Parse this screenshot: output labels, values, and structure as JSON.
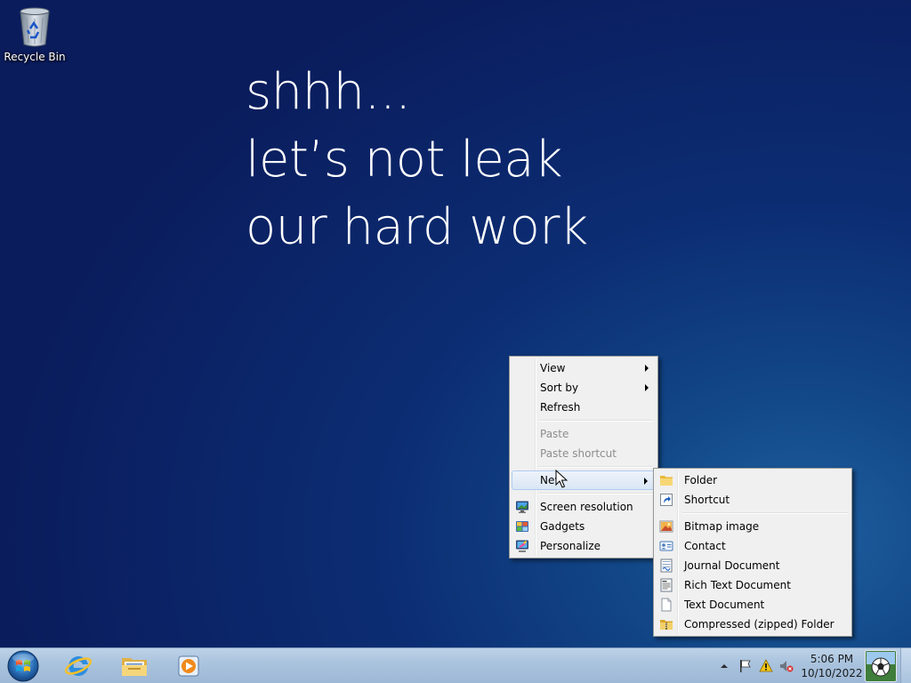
{
  "desktop": {
    "icons": [
      {
        "label": "Recycle Bin",
        "icon": "recycle-bin-icon"
      }
    ],
    "wallpaper_text": [
      "shhh...",
      "let’s not leak",
      "our hard work"
    ]
  },
  "context_menu": {
    "items": [
      {
        "label": "View",
        "has_submenu": true,
        "enabled": true
      },
      {
        "label": "Sort by",
        "has_submenu": true,
        "enabled": true
      },
      {
        "label": "Refresh",
        "enabled": true
      },
      {
        "label": "Paste",
        "enabled": false
      },
      {
        "label": "Paste shortcut",
        "enabled": false
      },
      {
        "label": "New",
        "has_submenu": true,
        "enabled": true,
        "highlighted": true
      },
      {
        "label": "Screen resolution",
        "icon": "monitor-icon",
        "enabled": true
      },
      {
        "label": "Gadgets",
        "icon": "gadgets-icon",
        "enabled": true
      },
      {
        "label": "Personalize",
        "icon": "personalize-icon",
        "enabled": true
      }
    ]
  },
  "new_submenu": {
    "items": [
      {
        "label": "Folder",
        "icon": "folder-icon"
      },
      {
        "label": "Shortcut",
        "icon": "shortcut-icon"
      },
      {
        "label": "Bitmap image",
        "icon": "bitmap-icon"
      },
      {
        "label": "Contact",
        "icon": "contact-icon"
      },
      {
        "label": "Journal Document",
        "icon": "journal-icon"
      },
      {
        "label": "Rich Text Document",
        "icon": "rich-text-icon"
      },
      {
        "label": "Text Document",
        "icon": "text-document-icon"
      },
      {
        "label": "Compressed (zipped) Folder",
        "icon": "zip-folder-icon"
      }
    ]
  },
  "taskbar": {
    "pinned": [
      "internet-explorer-icon",
      "windows-explorer-icon",
      "media-player-icon"
    ],
    "tray_icons": [
      "show-hidden-icons-arrow",
      "action-center-flag-icon",
      "warning-icon",
      "volume-muted-icon"
    ],
    "clock": {
      "time": "5:06 PM",
      "date": "10/10/2022"
    }
  },
  "colors": {
    "menu_bg": "#f0f0f0",
    "menu_highlight": "#dae6f5",
    "taskbar": "#a9c2dd",
    "wallpaper": "#0c2d73"
  }
}
